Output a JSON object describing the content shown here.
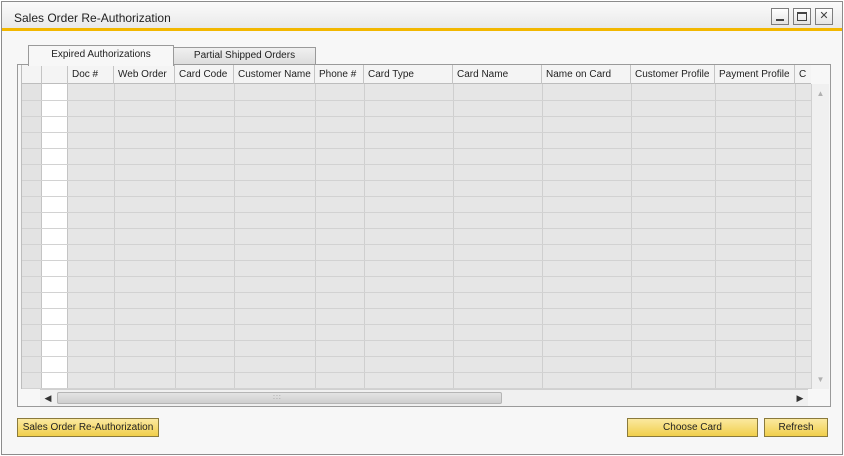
{
  "window": {
    "title": "Sales Order Re-Authorization",
    "accent_color": "#f2b700"
  },
  "tabs": [
    {
      "label": "Expired Authorizations",
      "active": true
    },
    {
      "label": "Partial Shipped Orders",
      "active": false
    }
  ],
  "grid": {
    "columns": [
      "Doc #",
      "Web Order",
      "Card Code",
      "Customer Name",
      "Phone #",
      "Card Type",
      "Card Name",
      "Name on Card",
      "Customer Profile",
      "Payment Profile",
      "C"
    ],
    "rows": []
  },
  "buttons": {
    "authorize": "Sales Order Re-Authorization",
    "choose_card": "Choose Card",
    "refresh": "Refresh"
  },
  "icons": {
    "minimize": "minimize-icon",
    "maximize": "maximize-icon",
    "close": "close-icon",
    "close_glyph": "✕",
    "scroll_up": "▲",
    "scroll_down": "▼",
    "scroll_left": "◀",
    "scroll_right": "▶",
    "grip": ":::"
  }
}
